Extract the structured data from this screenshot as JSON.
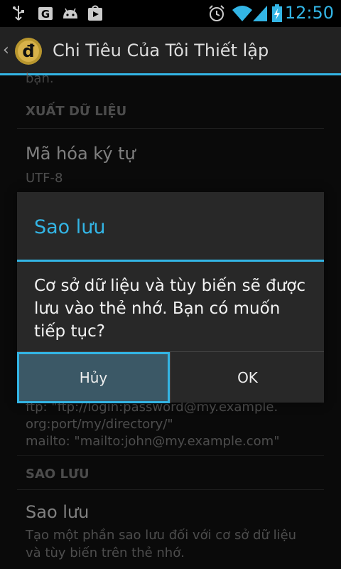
{
  "status_bar": {
    "time": "12:50",
    "colors": {
      "accent": "#33b5e5"
    },
    "icons": [
      "usb-icon",
      "g-icon",
      "android-icon",
      "play-store-icon",
      "alarm-icon",
      "wifi-icon",
      "signal-icon",
      "battery-charging-icon"
    ]
  },
  "action_bar": {
    "up_glyph": "‹",
    "app_icon_letter": "đ",
    "title": "Chi Tiêu Của Tôi Thiết lập"
  },
  "settings": {
    "cut_text": "bạn.",
    "export_category": "XUẤT DỮ LIỆU",
    "encoding_title": "Mã hóa ký tự",
    "encoding_value": "UTF-8",
    "ftp_line1": "ftp: \"ftp://login:password@my.example.",
    "ftp_line2": "org:port/my/directory/\"",
    "mailto_line": "mailto: \"mailto:john@my.example.com\"",
    "backup_category": "SAO LƯU",
    "backup_title": "Sao lưu",
    "backup_summary": "Tạo một phần sao lưu đối với cơ sở dữ liệu và tùy biến trên thẻ nhớ."
  },
  "dialog": {
    "title": "Sao lưu",
    "message": "Cơ sở dữ liệu và tùy biến sẽ được lưu vào thẻ nhớ. Bạn có muốn tiếp tục?",
    "cancel_label": "Hủy",
    "ok_label": "OK"
  }
}
